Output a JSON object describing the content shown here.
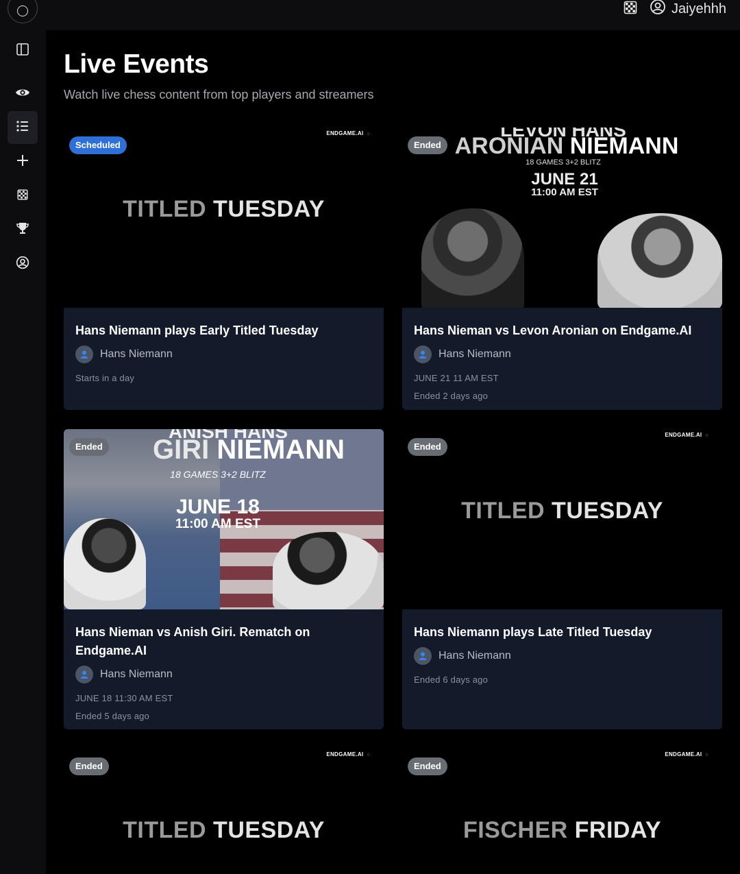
{
  "topbar": {
    "icons": [
      "logo-icon",
      "chessboard-icon",
      "user-circle-icon"
    ],
    "username": "Jaiyehhh"
  },
  "sidebar": {
    "items": [
      {
        "icon": "sidebar-toggle-icon",
        "active": false
      },
      {
        "icon": "eye-icon",
        "active": false
      },
      {
        "icon": "list-icon",
        "active": true
      },
      {
        "icon": "plus-icon",
        "active": false
      },
      {
        "icon": "chessboard-icon",
        "active": false
      },
      {
        "icon": "trophy-icon",
        "active": false
      },
      {
        "icon": "user-circle-icon",
        "active": false
      }
    ]
  },
  "page": {
    "title": "Live Events",
    "subtitle": "Watch live chess content from top players and streamers"
  },
  "cards": [
    {
      "badge": "Scheduled",
      "brand": "ENDGAME.AI",
      "poster_word1": "TITLED",
      "poster_word2": "TUESDAY",
      "title": "Hans Niemann plays Early Titled Tuesday",
      "host": "Hans Niemann",
      "meta1": "Starts in a day"
    },
    {
      "badge": "Ended",
      "poster_top": "LEVON HANS",
      "poster_name1": "ARONIAN",
      "poster_name2": "NIEMANN",
      "poster_format": "18 GAMES 3+2 BLITZ",
      "poster_date": "JUNE 21",
      "poster_time": "11:00 AM EST",
      "title": "Hans Nieman vs Levon Aronian on Endgame.AI",
      "host": "Hans Niemann",
      "meta1": "JUNE 21 11 AM EST",
      "meta2": "Ended 2 days ago"
    },
    {
      "badge": "Ended",
      "poster_top": "ANISH HANS",
      "poster_name1": "GIRI",
      "poster_name2": "NIEMANN",
      "poster_format": "18 GAMES 3+2 BLITZ",
      "poster_date": "JUNE 18",
      "poster_time": "11:00 AM EST",
      "title": "Hans Nieman vs Anish Giri. Rematch on Endgame.AI",
      "host": "Hans Niemann",
      "meta1": "JUNE 18 11:30 AM EST",
      "meta2": "Ended 5 days ago"
    },
    {
      "badge": "Ended",
      "brand": "ENDGAME.AI",
      "poster_word1": "TITLED",
      "poster_word2": "TUESDAY",
      "title": "Hans Niemann plays Late Titled Tuesday",
      "host": "Hans Niemann",
      "meta1": "Ended 6 days ago"
    },
    {
      "badge": "Ended",
      "brand": "ENDGAME.AI",
      "poster_word1": "TITLED",
      "poster_word2": "TUESDAY"
    },
    {
      "badge": "Ended",
      "brand": "ENDGAME.AI",
      "poster_word1": "FISCHER",
      "poster_word2": "FRIDAY"
    }
  ],
  "colors": {
    "background": "#000000",
    "sidebar": "#0d0d0f",
    "card_body": "#131a2a",
    "badge_scheduled": "#2f6fd8",
    "badge_ended": "#686c73"
  }
}
